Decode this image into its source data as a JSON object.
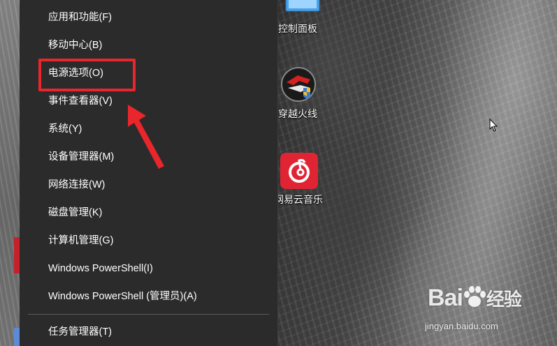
{
  "menu": {
    "items": [
      {
        "label": "应用和功能(F)"
      },
      {
        "label": "移动中心(B)"
      },
      {
        "label": "电源选项(O)"
      },
      {
        "label": "事件查看器(V)"
      },
      {
        "label": "系统(Y)"
      },
      {
        "label": "设备管理器(M)"
      },
      {
        "label": "网络连接(W)"
      },
      {
        "label": "磁盘管理(K)"
      },
      {
        "label": "计算机管理(G)"
      },
      {
        "label": "Windows PowerShell(I)"
      },
      {
        "label": "Windows PowerShell (管理员)(A)"
      },
      {
        "label": "任务管理器(T)"
      }
    ]
  },
  "desktop": {
    "icons": [
      {
        "label": "控制面板",
        "icon": "control-panel-icon"
      },
      {
        "label": "穿越火线",
        "icon": "crossfire-icon"
      },
      {
        "label": "网易云音乐",
        "icon": "netease-music-icon"
      }
    ]
  },
  "watermark": {
    "logo": "Bai",
    "logo_suffix": "经验",
    "url": "jingyan.baidu.com"
  },
  "colors": {
    "menu_bg": "#2b2b2b",
    "annotation_red": "#e8262b"
  }
}
